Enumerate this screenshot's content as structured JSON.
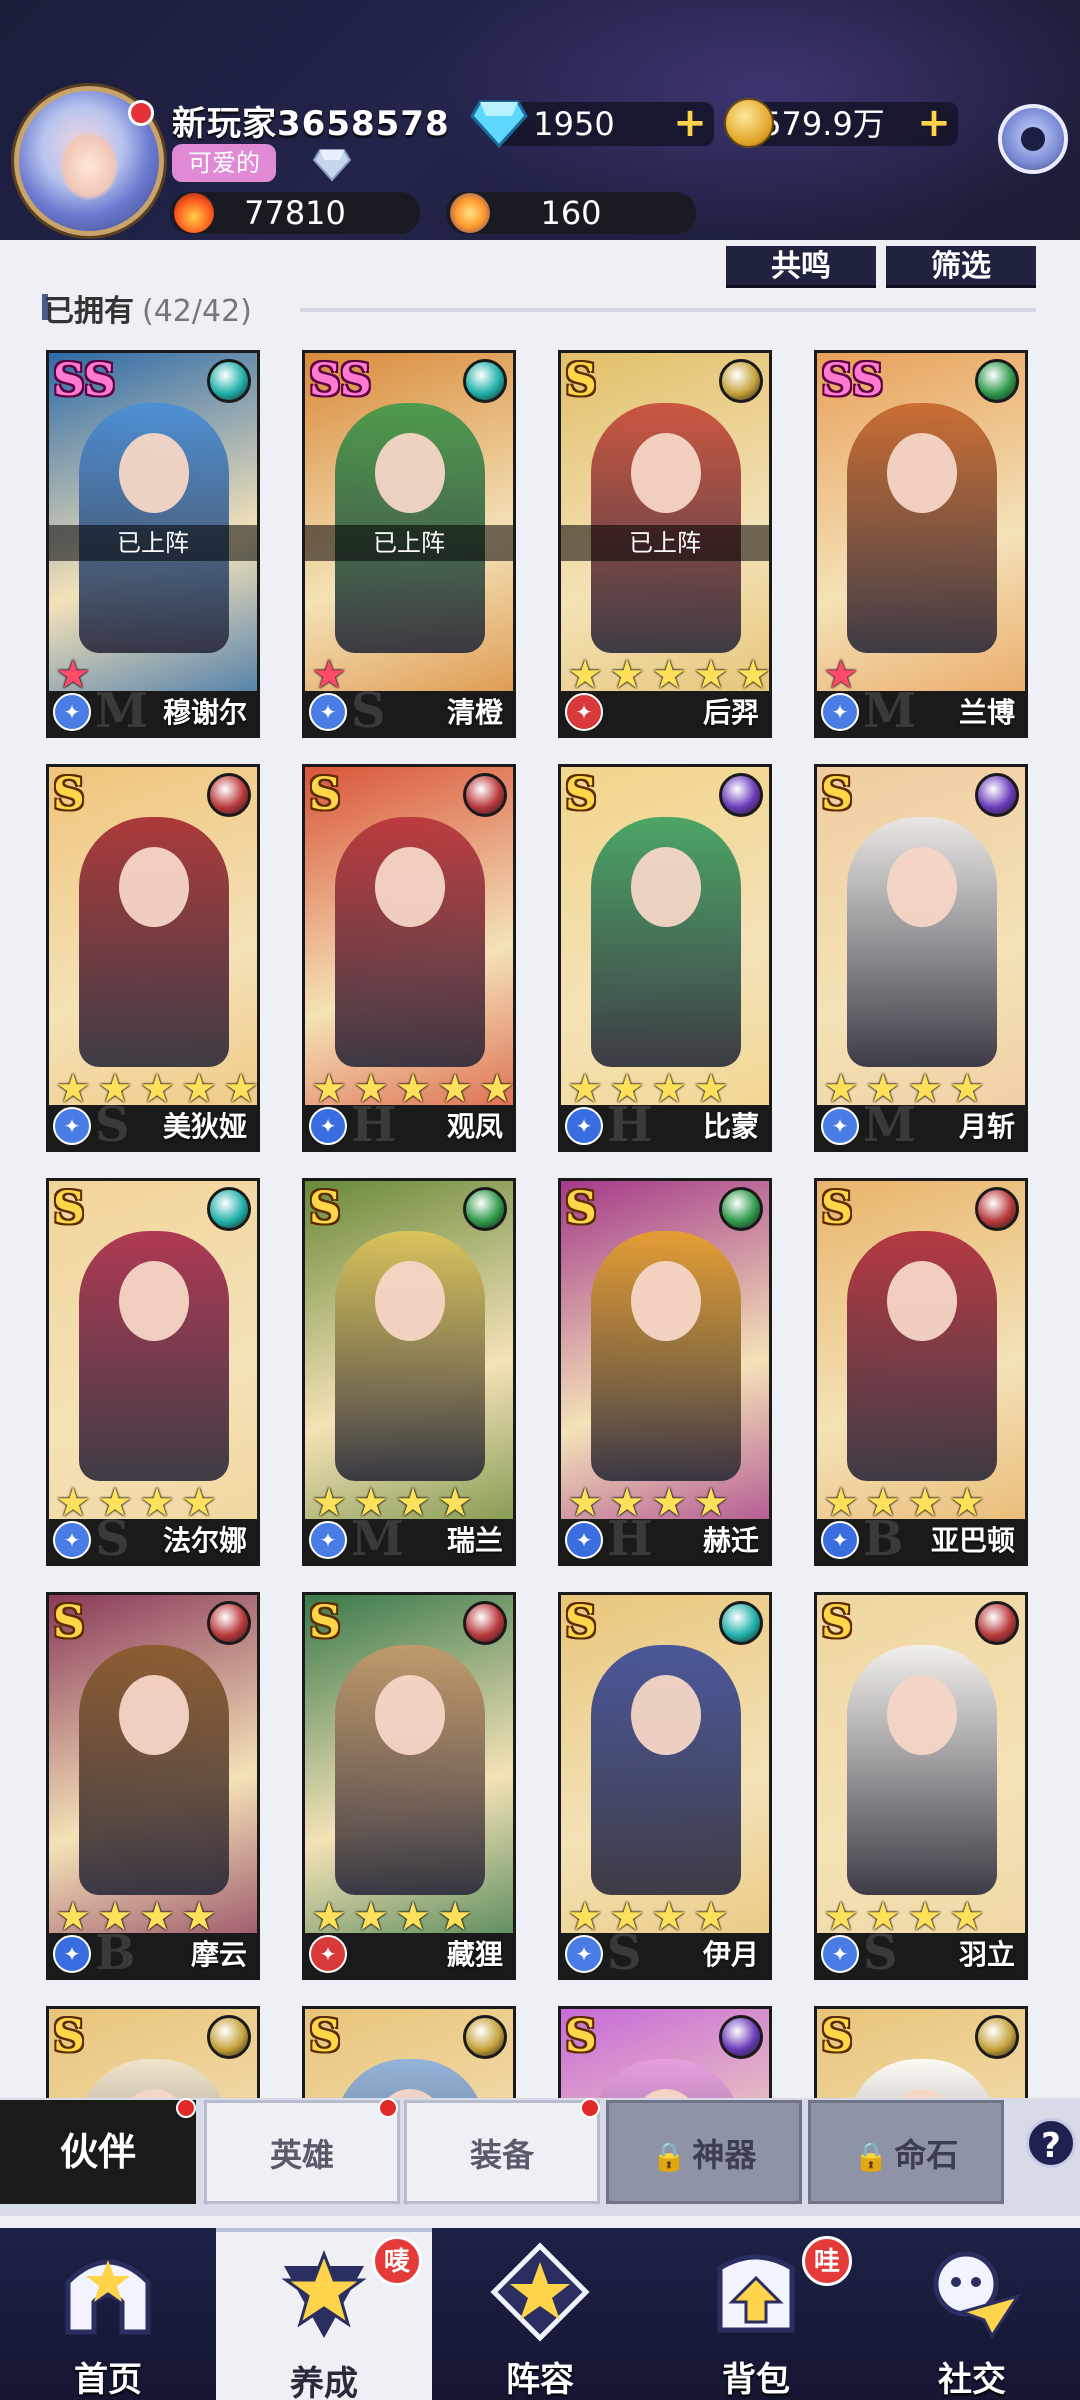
{
  "player": {
    "name": "新玩家3658578",
    "title": "可爱的",
    "power": "77810",
    "energy": "160"
  },
  "currency": {
    "gems": "1950",
    "gold": "579.9万"
  },
  "actions": {
    "resonate": "共鸣",
    "filter": "筛选"
  },
  "section": {
    "title": "已拥有",
    "count": "(42/42)"
  },
  "deployed_label": "已上阵",
  "heroes": [
    {
      "name": "穆谢尔",
      "rarity": "SS",
      "deployed": true,
      "stars": 1,
      "red": true,
      "cls": "M",
      "elem": "#1fb0a8",
      "bg": "#2e6aa8",
      "fig": "#4a8fd8"
    },
    {
      "name": "清橙",
      "rarity": "SS",
      "deployed": true,
      "stars": 1,
      "red": true,
      "cls": "S",
      "elem": "#1fb0a8",
      "bg": "#d98a3a",
      "fig": "#3f9a4a"
    },
    {
      "name": "后羿",
      "rarity": "S",
      "deployed": true,
      "stars": 5,
      "red": false,
      "cls": "",
      "elem": "#c6a23a",
      "bg": "#e2c06a",
      "fig": "#c84a3a"
    },
    {
      "name": "兰博",
      "rarity": "SS",
      "deployed": false,
      "stars": 1,
      "red": true,
      "cls": "M",
      "elem": "#2f9a4a",
      "bg": "#e8a05a",
      "fig": "#c7662c"
    },
    {
      "name": "美狄娅",
      "rarity": "S",
      "deployed": false,
      "stars": 5,
      "red": false,
      "cls": "S",
      "elem": "#b8383a",
      "bg": "#f0c47a",
      "fig": "#a42a30"
    },
    {
      "name": "观凤",
      "rarity": "S",
      "deployed": false,
      "stars": 5,
      "red": false,
      "cls": "H",
      "elem": "#b8383a",
      "bg": "#d9553a",
      "fig": "#b8343a"
    },
    {
      "name": "比蒙",
      "rarity": "S",
      "deployed": false,
      "stars": 4,
      "red": false,
      "cls": "H",
      "elem": "#6a3ab8",
      "bg": "#f2d58a",
      "fig": "#3aa060"
    },
    {
      "name": "月斩",
      "rarity": "S",
      "deployed": false,
      "stars": 4,
      "red": false,
      "cls": "M",
      "elem": "#6a3ab8",
      "bg": "#f0cca0",
      "fig": "#e8e8ea"
    },
    {
      "name": "法尔娜",
      "rarity": "S",
      "deployed": false,
      "stars": 4,
      "red": false,
      "cls": "S",
      "elem": "#1fb0a8",
      "bg": "#f2d49a",
      "fig": "#a8284a"
    },
    {
      "name": "瑞兰",
      "rarity": "S",
      "deployed": false,
      "stars": 4,
      "red": false,
      "cls": "M",
      "elem": "#2f9a4a",
      "bg": "#6a8a3a",
      "fig": "#e0c65a"
    },
    {
      "name": "赫迁",
      "rarity": "S",
      "deployed": false,
      "stars": 4,
      "red": false,
      "cls": "H",
      "elem": "#2f9a4a",
      "bg": "#a43a8a",
      "fig": "#e8a22a"
    },
    {
      "name": "亚巴顿",
      "rarity": "S",
      "deployed": false,
      "stars": 4,
      "red": false,
      "cls": "B",
      "elem": "#b8383a",
      "bg": "#e8b46a",
      "fig": "#b02a3a"
    },
    {
      "name": "摩云",
      "rarity": "S",
      "deployed": false,
      "stars": 4,
      "red": false,
      "cls": "B",
      "elem": "#b8383a",
      "bg": "#8a3a5a",
      "fig": "#8a5a2a"
    },
    {
      "name": "藏狸",
      "rarity": "S",
      "deployed": false,
      "stars": 4,
      "red": false,
      "cls": "",
      "elem": "#b8383a",
      "bg": "#3a7a4a",
      "fig": "#c89a6a"
    },
    {
      "name": "伊月",
      "rarity": "S",
      "deployed": false,
      "stars": 4,
      "red": false,
      "cls": "S",
      "elem": "#1fb0a8",
      "bg": "#e8c67a",
      "fig": "#3a4a9a"
    },
    {
      "name": "羽立",
      "rarity": "S",
      "deployed": false,
      "stars": 4,
      "red": false,
      "cls": "S",
      "elem": "#b8383a",
      "bg": "#f0d6a0",
      "fig": "#f2f2f2"
    },
    {
      "name": "",
      "rarity": "S",
      "deployed": false,
      "stars": 0,
      "red": false,
      "cls": "",
      "elem": "#c6a23a",
      "bg": "#e8c47a",
      "fig": "#f0e6d0"
    },
    {
      "name": "",
      "rarity": "S",
      "deployed": false,
      "stars": 0,
      "red": false,
      "cls": "",
      "elem": "#c6a23a",
      "bg": "#e8c47a",
      "fig": "#8ab0e0"
    },
    {
      "name": "",
      "rarity": "S",
      "deployed": false,
      "stars": 0,
      "red": false,
      "cls": "",
      "elem": "#6a3ab8",
      "bg": "#c86ad8",
      "fig": "#e8a0e0"
    },
    {
      "name": "",
      "rarity": "S",
      "deployed": false,
      "stars": 0,
      "red": false,
      "cls": "",
      "elem": "#c6a23a",
      "bg": "#e8c47a",
      "fig": "#ffffff"
    }
  ],
  "subtabs": {
    "partner": "伙伴",
    "hero": "英雄",
    "equipment": "装备",
    "artifact": "神器",
    "fate_stone": "命石",
    "help": "?"
  },
  "nav": {
    "home": "首页",
    "develop": "养成",
    "lineup": "阵容",
    "bag": "背包",
    "social": "社交",
    "develop_badge": "唛",
    "bag_badge": "哇"
  }
}
